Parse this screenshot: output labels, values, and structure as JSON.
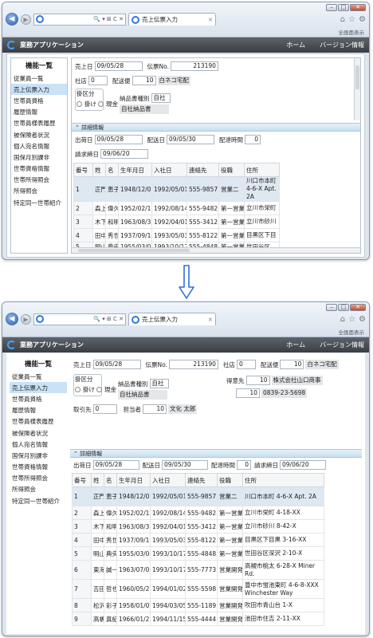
{
  "browser": {
    "address_icon": "ie-icon",
    "address_tools": "🔍 ▾ ⊞ C ✕",
    "tab_title": "売上伝票入力",
    "tab_close": "×",
    "command_bar": "全画面表示",
    "tool_icons": [
      "home-icon",
      "star-icon",
      "gear-icon"
    ]
  },
  "app": {
    "title": "業務アプリケーション",
    "menu": [
      "ホーム",
      "バージョン情報"
    ]
  },
  "sidebar": {
    "title": "機能一覧",
    "items": [
      "従業員一覧",
      "売上伝票入力",
      "世帯員資格",
      "履歴情報",
      "世帯員様表履歴",
      "被保険者状況",
      "個人宛名情報",
      "国保月別課非",
      "世帯資格情報",
      "世帯所得照会",
      "所得照会",
      "特定同一世帯紹介"
    ],
    "selected_index": 1
  },
  "form": {
    "sales_date_label": "売上日",
    "sales_date": "09/05/28",
    "slip_no_label": "伝票No.",
    "slip_no": "213190",
    "company_label": "社店",
    "company": "0",
    "delivery_label": "配送便",
    "delivery_code": "10",
    "delivery_name": "白ネコ宅配",
    "category_label": "掛区分",
    "radio_credit": "掛け",
    "radio_cash": "現金",
    "doc_type_label": "納品書種別",
    "doc_type": "自社",
    "doc_type_name": "自社納品書",
    "customer_label": "得意先",
    "customer_code": "10",
    "customer_name": "株式会社山口商事",
    "phone_code": "10",
    "phone": "0839-23-5698",
    "supplier_label": "取引先",
    "supplier": "0",
    "staff_label": "担当者",
    "staff_code": "10",
    "staff_name": "文化 太郎"
  },
  "detail": {
    "header": "詳細情報",
    "ship_date_label": "出荷日",
    "ship_date": "09/05/28",
    "delivery_date_label": "配送日",
    "delivery_date": "09/05/30",
    "delivery_time_label": "配達時間",
    "delivery_time": "0",
    "billing_date_label": "請求締日",
    "billing_date": "09/06/20"
  },
  "table": {
    "columns": [
      "番号",
      "姓",
      "名",
      "生年月日",
      "入社日",
      "連絡先",
      "役職",
      "住所"
    ],
    "rows": [
      [
        "1",
        "正門",
        "恵子",
        "1948/12/08",
        "1992/05/01",
        "555-9857",
        "営業二",
        "川口市本町 4-6-X Apt. 2A"
      ],
      [
        "2",
        "森上",
        "偉久",
        "1952/02/19",
        "1992/08/14",
        "555-9482",
        "第一営業",
        "立川市栄町 4-18-XX"
      ],
      [
        "3",
        "木下",
        "和明",
        "1963/08/30",
        "1992/04/01",
        "555-3412",
        "第一営業",
        "立川市砂川 8-42-X"
      ],
      [
        "4",
        "田中",
        "秀世",
        "1937/09/19",
        "1993/05/03",
        "555-8122",
        "第一営業",
        "目黒区下目黒 3-16-XX"
      ],
      [
        "5",
        "明山",
        "典央",
        "1955/03/04",
        "1993/10/17",
        "555-4848",
        "第一営業",
        "世田谷区深沢 2-10-X"
      ],
      [
        "6",
        "東海",
        "誠一",
        "1963/07/02",
        "1993/10/17",
        "555-7773",
        "営業開発",
        "高槻市桃太 6-28-X Miner Rd."
      ],
      [
        "7",
        "吉田",
        "哲也",
        "1960/05/29",
        "1994/01/02",
        "555-5598",
        "営業開発",
        "豊中市蛍池東町 4-6-8-XXX Winchester Way"
      ],
      [
        "8",
        "松沢",
        "彩子",
        "1958/01/09",
        "1994/03/05",
        "555-1189",
        "営業開発",
        "吹田市青山台 1-X"
      ],
      [
        "9",
        "高橋",
        "真紀",
        "1966/01/27",
        "1994/11/15",
        "555-4444",
        "営業開発",
        "池田市住吉 2-11-XX"
      ]
    ],
    "rows_before": [
      [
        "1",
        "正門",
        "恵子",
        "1948/12/08",
        "1992/05/01",
        "555-9857",
        "営業二",
        "川口市本町 4-6-X Apt. 2A"
      ],
      [
        "2",
        "森上",
        "偉久",
        "1952/02/19",
        "1992/08/14",
        "555-9482",
        "第一営業",
        "立川市栄町"
      ],
      [
        "3",
        "木下",
        "和明",
        "1963/08/30",
        "1992/04/01",
        "555-3412",
        "第一営業",
        "立川市砂川"
      ],
      [
        "4",
        "田中",
        "秀世",
        "1937/09/19",
        "1993/05/03",
        "555-8122",
        "第一営業",
        "目黒区下目"
      ],
      [
        "5",
        "明山",
        "典央",
        "1955/03/04",
        "1993/10/17",
        "555-4848",
        "第一営業",
        "世田谷区"
      ]
    ]
  },
  "arrow_icon": "down-arrow-icon"
}
